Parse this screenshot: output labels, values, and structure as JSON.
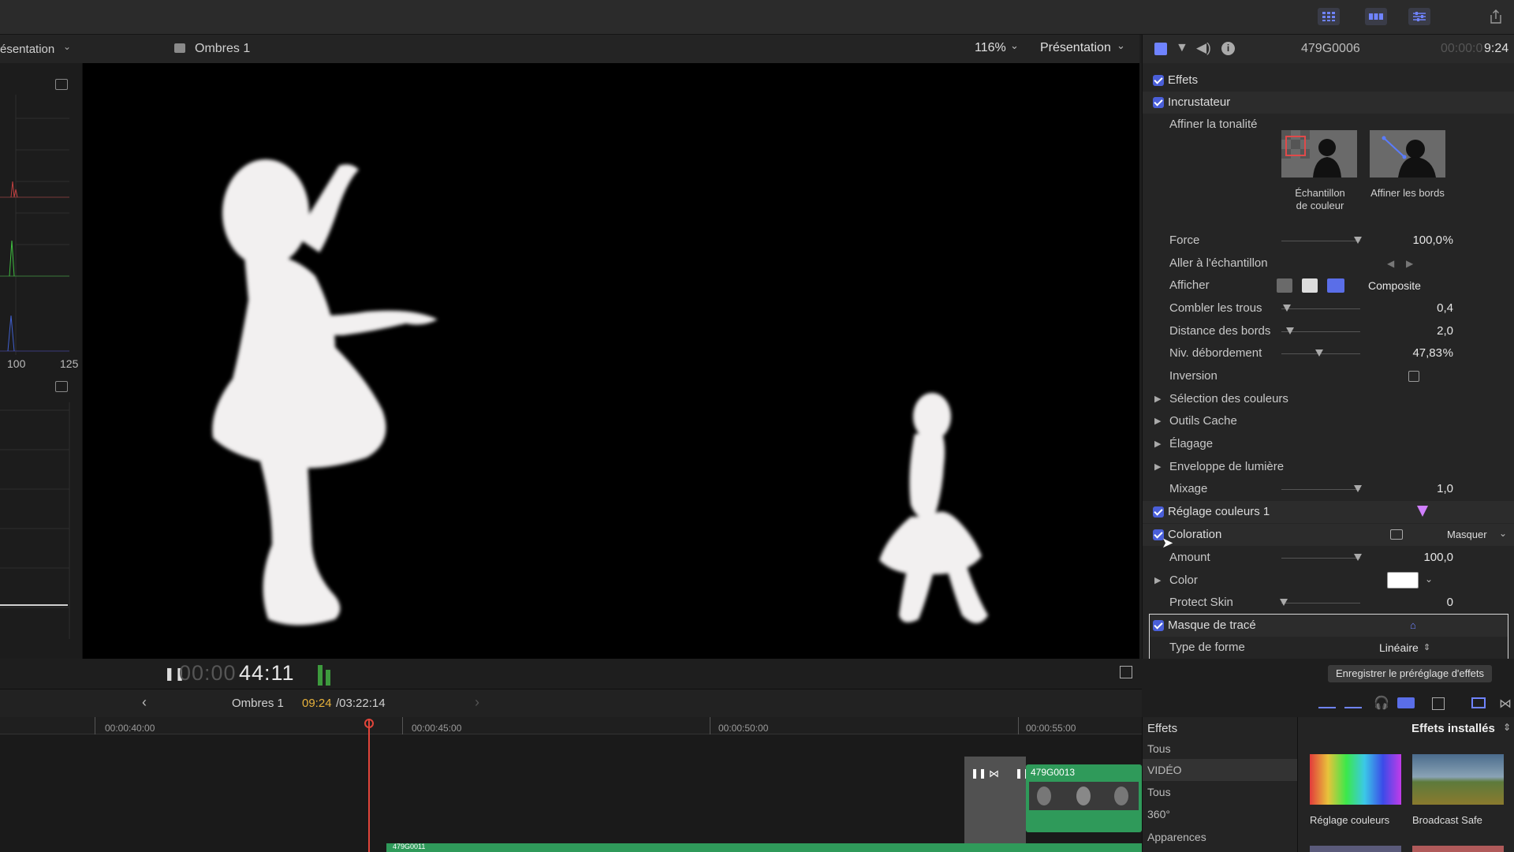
{
  "toolbar": {
    "icons": [
      "grid-view-icon",
      "filmstrip-icon",
      "sliders-icon",
      "share-icon"
    ]
  },
  "viewer": {
    "project_name": "Ombres 1",
    "zoom": "116%",
    "view_menu": "Présentation",
    "left_panel_menu": "ésentation",
    "scope_labels": [
      "100",
      "125"
    ],
    "timecode_dim": "00:00",
    "timecode_main": "44:11"
  },
  "inspector": {
    "clip_name": "479G0006",
    "clip_timecode_dim": "00:00:0",
    "clip_timecode": "9:24",
    "effects_title": "Effets",
    "keyer": {
      "title": "Incrustateur",
      "refine_label": "Affiner la tonalité",
      "sample_color_label_1": "Échantillon",
      "sample_color_label_2": "de couleur",
      "refine_edges_label": "Affiner les bords",
      "force_label": "Force",
      "force_value": "100,0",
      "force_unit": "%",
      "force_level": 0.97,
      "go_to_sample_label": "Aller à l'échantillon",
      "view_label": "Afficher",
      "view_value": "Composite",
      "fill_holes_label": "Combler les trous",
      "fill_holes_value": "0,4",
      "fill_holes_level": 0.07,
      "edge_distance_label": "Distance des bords",
      "edge_distance_value": "2,0",
      "edge_distance_level": 0.11,
      "spill_label": "Niv. débordement",
      "spill_value": "47,83",
      "spill_unit": "%",
      "spill_level": 0.48,
      "invert_label": "Inversion",
      "color_selection_label": "Sélection des couleurs",
      "matte_tools_label": "Outils Cache",
      "trim_label": "Élagage",
      "light_wrap_label": "Enveloppe de lumière",
      "mix_label": "Mixage",
      "mix_value": "1,0",
      "mix_level": 0.97
    },
    "color_adjust": {
      "title": "Réglage couleurs 1"
    },
    "colorize": {
      "title": "Coloration",
      "mask_menu": "Masquer",
      "amount_label": "Amount",
      "amount_value": "100,0",
      "amount_level": 0.97,
      "color_label": "Color",
      "color_swatch": "#ffffff",
      "protect_skin_label": "Protect Skin",
      "protect_skin_value": "0",
      "protect_skin_level": 0.03
    },
    "shape_mask": {
      "title": "Masque de tracé",
      "shape_type_label": "Type de forme",
      "shape_type_value": "Linéaire"
    },
    "save_preset_button": "Enregistrer le préréglage d'effets"
  },
  "timeline": {
    "project_name": "Ombres 1",
    "current_tc": "09:24",
    "duration_tc": "/03:22:14",
    "ruler": [
      "00:00:40:00",
      "00:00:45:00",
      "00:00:50:00",
      "00:00:55:00"
    ],
    "clip_name": "479G0013",
    "lower_clip_name": "479G0011"
  },
  "effects_browser": {
    "title": "Effets",
    "installed_menu": "Effets installés",
    "categories": [
      "Tous",
      "VIDÉO",
      "Tous",
      "360°",
      "Apparences"
    ],
    "items": [
      "Réglage couleurs",
      "Broadcast Safe"
    ]
  },
  "colors": {
    "accent": "#4a5fd9",
    "playhead": "#e0453a",
    "clip_green": "#2f9a5a",
    "timecode_highlight": "#e8b23c"
  }
}
